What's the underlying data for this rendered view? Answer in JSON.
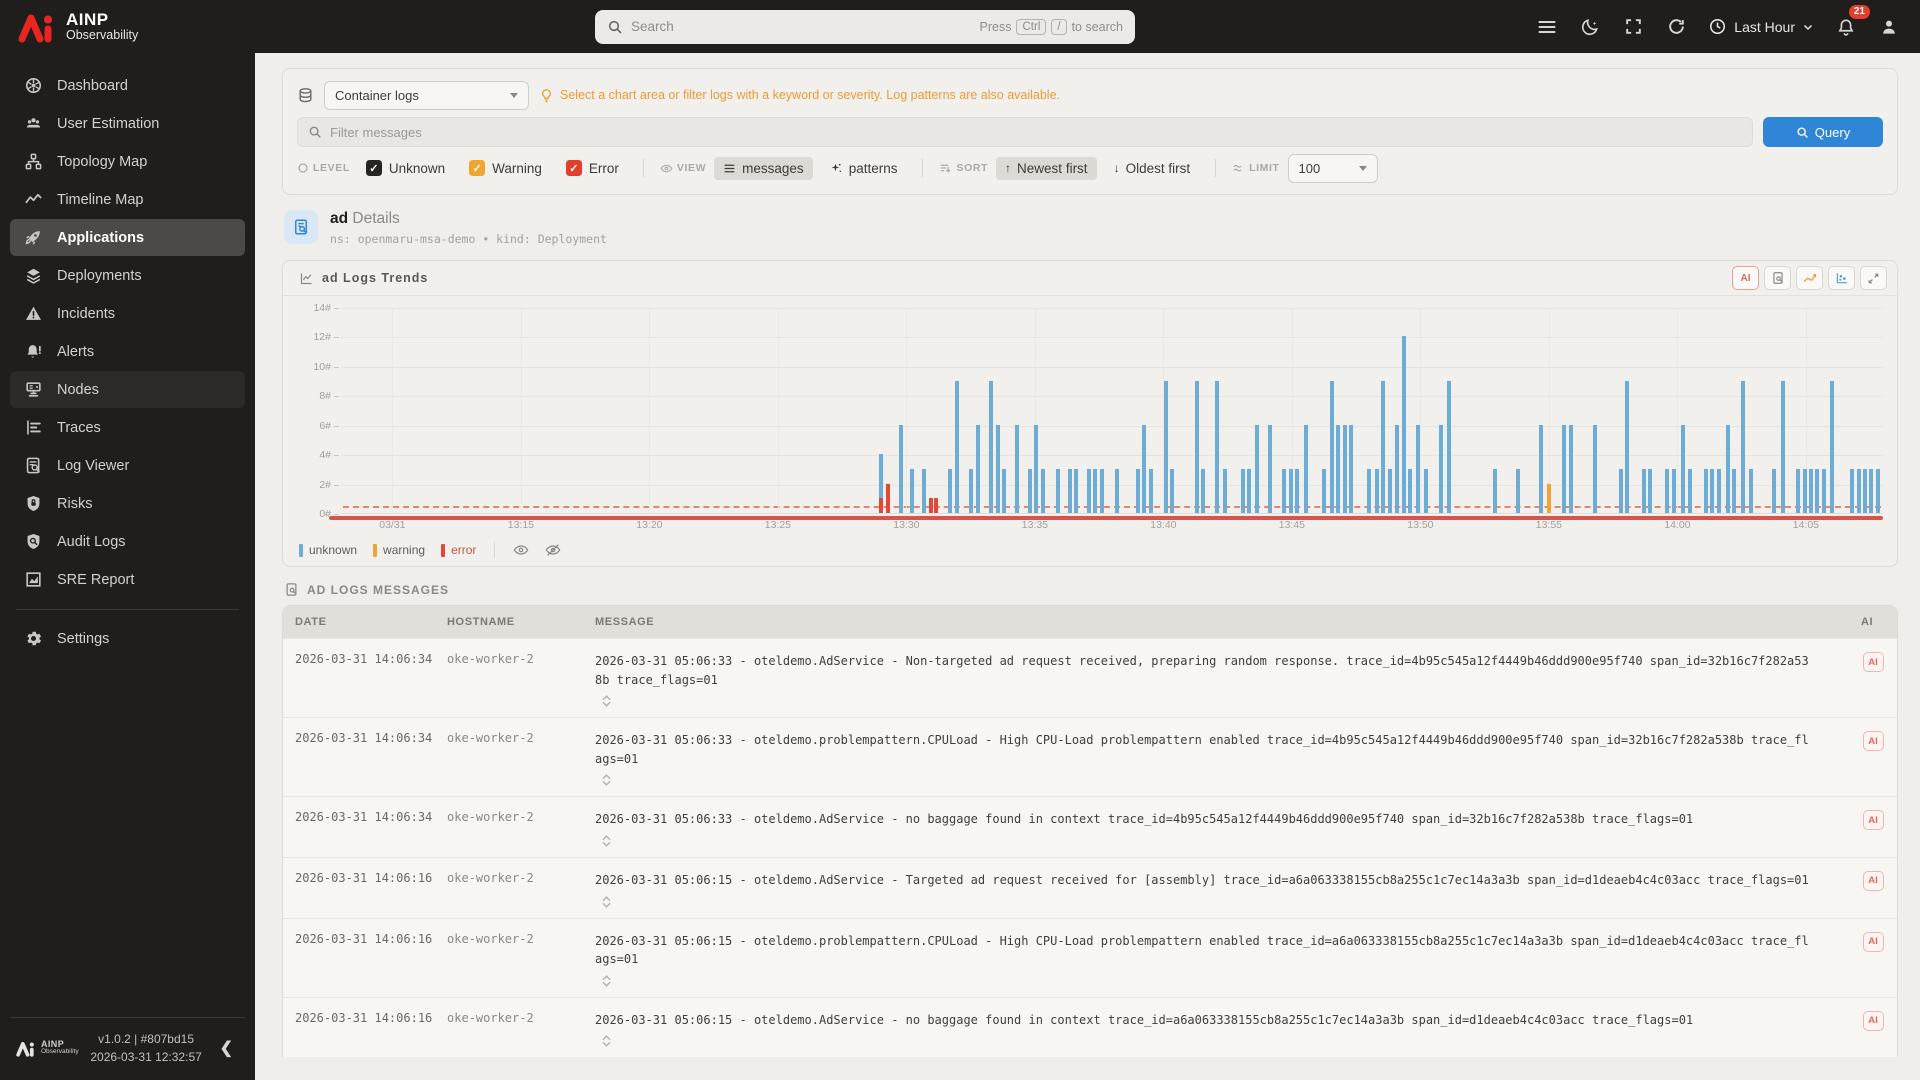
{
  "brand": {
    "name": "AINP",
    "product": "Observability"
  },
  "topbar": {
    "search_placeholder": "Search",
    "hint_press": "Press",
    "hint_key1": "Ctrl",
    "hint_key2": "/",
    "hint_suffix": "to search",
    "time_range": "Last Hour",
    "notification_count": "21"
  },
  "sidebar": {
    "items": [
      {
        "label": "Dashboard",
        "icon": "dashboard-icon",
        "state": "normal"
      },
      {
        "label": "User Estimation",
        "icon": "user-estimation-icon",
        "state": "normal"
      },
      {
        "label": "Topology Map",
        "icon": "topology-map-icon",
        "state": "normal"
      },
      {
        "label": "Timeline Map",
        "icon": "timeline-map-icon",
        "state": "normal"
      },
      {
        "label": "Applications",
        "icon": "applications-icon",
        "state": "active"
      },
      {
        "label": "Deployments",
        "icon": "deployments-icon",
        "state": "normal"
      },
      {
        "label": "Incidents",
        "icon": "incidents-icon",
        "state": "normal"
      },
      {
        "label": "Alerts",
        "icon": "alerts-icon",
        "state": "normal"
      },
      {
        "label": "Nodes",
        "icon": "nodes-icon",
        "state": "hovered"
      },
      {
        "label": "Traces",
        "icon": "traces-icon",
        "state": "normal"
      },
      {
        "label": "Log Viewer",
        "icon": "log-viewer-icon",
        "state": "normal"
      },
      {
        "label": "Risks",
        "icon": "risks-icon",
        "state": "normal"
      },
      {
        "label": "Audit Logs",
        "icon": "audit-logs-icon",
        "state": "normal"
      },
      {
        "label": "SRE Report",
        "icon": "sre-report-icon",
        "state": "normal"
      }
    ],
    "settings_label": "Settings",
    "footer": {
      "version": "v1.0.2 | #807bd15",
      "timestamp": "2026-03-31 12:32:57"
    }
  },
  "filters": {
    "source": "Container logs",
    "hint": "Select a chart area or filter logs with a keyword or severity. Log patterns are also available.",
    "filter_placeholder": "Filter messages",
    "query_label": "Query",
    "level_label": "LEVEL",
    "levels": [
      {
        "label": "Unknown",
        "color": "#262523",
        "checked": true
      },
      {
        "label": "Warning",
        "color": "#f0a432",
        "checked": true
      },
      {
        "label": "Error",
        "color": "#e23f2e",
        "checked": true
      }
    ],
    "view_label": "VIEW",
    "views": [
      {
        "label": "messages",
        "selected": true
      },
      {
        "label": "patterns",
        "selected": false
      }
    ],
    "sort_label": "SORT",
    "sorts": [
      {
        "label": "Newest first",
        "selected": true
      },
      {
        "label": "Oldest first",
        "selected": false
      }
    ],
    "limit_label": "LIMIT",
    "limit_value": "100"
  },
  "details": {
    "name": "ad",
    "title": "Details",
    "meta": "ns: openmaru-msa-demo • kind: Deployment"
  },
  "chart": {
    "title": "ad Logs Trends",
    "ai_button": "AI",
    "legend": [
      {
        "label": "unknown",
        "color": "#6dacd4"
      },
      {
        "label": "warning",
        "color": "#f0a432"
      },
      {
        "label": "error",
        "color": "#dd4a38"
      }
    ]
  },
  "chart_data": {
    "type": "bar",
    "stacked": true,
    "title": "ad Logs Trends",
    "ylim": [
      0,
      14
    ],
    "yticks": [
      "0#",
      "2#",
      "4#",
      "6#",
      "8#",
      "10#",
      "12#",
      "14#"
    ],
    "x_domain_minutes": 60,
    "x_start": "13:08",
    "xticks": [
      {
        "offset": 2,
        "label": "03/31"
      },
      {
        "offset": 7,
        "label": "13:15"
      },
      {
        "offset": 12,
        "label": "13:20"
      },
      {
        "offset": 17,
        "label": "13:25"
      },
      {
        "offset": 22,
        "label": "13:30"
      },
      {
        "offset": 27,
        "label": "13:35"
      },
      {
        "offset": 32,
        "label": "13:40"
      },
      {
        "offset": 37,
        "label": "13:45"
      },
      {
        "offset": 42,
        "label": "13:50"
      },
      {
        "offset": 47,
        "label": "13:55"
      },
      {
        "offset": 52,
        "label": "14:00"
      },
      {
        "offset": 57,
        "label": "14:05"
      }
    ],
    "series_order": [
      "error",
      "warning",
      "unknown"
    ],
    "colors": {
      "unknown": "#6dacd4",
      "warning": "#f0a432",
      "error": "#dd4a38"
    },
    "threshold_line": {
      "y": 0.5,
      "style": "dashed",
      "color": "#e0604e"
    },
    "bars": [
      [
        21.0,
        3,
        0,
        1
      ],
      [
        21.3,
        0,
        0,
        2
      ],
      [
        21.8,
        6,
        0,
        0
      ],
      [
        22.2,
        3,
        0,
        0
      ],
      [
        22.7,
        3,
        0,
        0
      ],
      [
        22.95,
        0,
        0,
        1
      ],
      [
        23.15,
        0,
        0,
        1
      ],
      [
        23.7,
        3,
        0,
        0
      ],
      [
        23.95,
        9,
        0,
        0
      ],
      [
        24.5,
        3,
        0,
        0
      ],
      [
        24.8,
        6,
        0,
        0
      ],
      [
        25.3,
        9,
        0,
        0
      ],
      [
        25.55,
        6,
        0,
        0
      ],
      [
        25.8,
        3,
        0,
        0
      ],
      [
        26.3,
        6,
        0,
        0
      ],
      [
        26.8,
        3,
        0,
        0
      ],
      [
        27.05,
        6,
        0,
        0
      ],
      [
        27.3,
        3,
        0,
        0
      ],
      [
        27.9,
        3,
        0,
        0
      ],
      [
        28.35,
        3,
        0,
        0
      ],
      [
        28.6,
        3,
        0,
        0
      ],
      [
        29.1,
        3,
        0,
        0
      ],
      [
        29.35,
        3,
        0,
        0
      ],
      [
        29.6,
        3,
        0,
        0
      ],
      [
        30.2,
        3,
        0,
        0
      ],
      [
        31.0,
        3,
        0,
        0
      ],
      [
        31.25,
        6,
        0,
        0
      ],
      [
        31.5,
        3,
        0,
        0
      ],
      [
        32.1,
        9,
        0,
        0
      ],
      [
        32.35,
        3,
        0,
        0
      ],
      [
        33.3,
        9,
        0,
        0
      ],
      [
        33.55,
        3,
        0,
        0
      ],
      [
        34.1,
        9,
        0,
        0
      ],
      [
        34.4,
        3,
        0,
        0
      ],
      [
        35.1,
        3,
        0,
        0
      ],
      [
        35.35,
        3,
        0,
        0
      ],
      [
        35.65,
        6,
        0,
        0
      ],
      [
        36.15,
        6,
        0,
        0
      ],
      [
        36.7,
        3,
        0,
        0
      ],
      [
        36.95,
        3,
        0,
        0
      ],
      [
        37.2,
        3,
        0,
        0
      ],
      [
        37.55,
        6,
        0,
        0
      ],
      [
        38.25,
        3,
        0,
        0
      ],
      [
        38.55,
        9,
        0,
        0
      ],
      [
        38.8,
        6,
        0,
        0
      ],
      [
        39.05,
        6,
        0,
        0
      ],
      [
        39.3,
        6,
        0,
        0
      ],
      [
        40.0,
        3,
        0,
        0
      ],
      [
        40.3,
        3,
        0,
        0
      ],
      [
        40.55,
        9,
        0,
        0
      ],
      [
        40.8,
        3,
        0,
        0
      ],
      [
        41.1,
        6,
        0,
        0
      ],
      [
        41.35,
        12,
        0,
        0
      ],
      [
        41.6,
        3,
        0,
        0
      ],
      [
        41.9,
        6,
        0,
        0
      ],
      [
        42.2,
        3,
        0,
        0
      ],
      [
        42.8,
        6,
        0,
        0
      ],
      [
        43.1,
        9,
        0,
        0
      ],
      [
        44.9,
        3,
        0,
        0
      ],
      [
        45.8,
        3,
        0,
        0
      ],
      [
        46.7,
        6,
        0,
        0
      ],
      [
        47.0,
        0,
        2,
        0
      ],
      [
        47.6,
        6,
        0,
        0
      ],
      [
        47.85,
        6,
        0,
        0
      ],
      [
        48.8,
        6,
        0,
        0
      ],
      [
        49.8,
        3,
        0,
        0
      ],
      [
        50.05,
        9,
        0,
        0
      ],
      [
        50.7,
        3,
        0,
        0
      ],
      [
        50.95,
        3,
        0,
        0
      ],
      [
        51.6,
        3,
        0,
        0
      ],
      [
        51.85,
        3,
        0,
        0
      ],
      [
        52.2,
        6,
        0,
        0
      ],
      [
        52.5,
        3,
        0,
        0
      ],
      [
        53.1,
        3,
        0,
        0
      ],
      [
        53.35,
        3,
        0,
        0
      ],
      [
        53.6,
        3,
        0,
        0
      ],
      [
        53.95,
        6,
        0,
        0
      ],
      [
        54.2,
        3,
        0,
        0
      ],
      [
        54.55,
        9,
        0,
        0
      ],
      [
        54.85,
        3,
        0,
        0
      ],
      [
        55.75,
        3,
        0,
        0
      ],
      [
        56.1,
        9,
        0,
        0
      ],
      [
        56.7,
        3,
        0,
        0
      ],
      [
        56.95,
        3,
        0,
        0
      ],
      [
        57.2,
        3,
        0,
        0
      ],
      [
        57.45,
        3,
        0,
        0
      ],
      [
        57.7,
        3,
        0,
        0
      ],
      [
        58.0,
        9,
        0,
        0
      ],
      [
        58.8,
        3,
        0,
        0
      ],
      [
        59.05,
        3,
        0,
        0
      ],
      [
        59.3,
        3,
        0,
        0
      ],
      [
        59.55,
        3,
        0,
        0
      ],
      [
        59.8,
        3,
        0,
        0
      ]
    ]
  },
  "table": {
    "section_title": "AD LOGS MESSAGES",
    "columns": [
      "DATE",
      "HOSTNAME",
      "MESSAGE",
      "AI"
    ],
    "ai_badge": "AI",
    "rows": [
      {
        "date": "2026-03-31 14:06:34",
        "host": "oke-worker-2",
        "message": "2026-03-31 05:06:33 - oteldemo.AdService - Non-targeted ad request received, preparing random response. trace_id=4b95c545a12f4449b46ddd900e95f740 span_id=32b16c7f282a538b trace_flags=01"
      },
      {
        "date": "2026-03-31 14:06:34",
        "host": "oke-worker-2",
        "message": "2026-03-31 05:06:33 - oteldemo.problempattern.CPULoad - High CPU-Load problempattern enabled trace_id=4b95c545a12f4449b46ddd900e95f740 span_id=32b16c7f282a538b trace_flags=01"
      },
      {
        "date": "2026-03-31 14:06:34",
        "host": "oke-worker-2",
        "message": "2026-03-31 05:06:33 - oteldemo.AdService - no baggage found in context trace_id=4b95c545a12f4449b46ddd900e95f740 span_id=32b16c7f282a538b trace_flags=01"
      },
      {
        "date": "2026-03-31 14:06:16",
        "host": "oke-worker-2",
        "message": "2026-03-31 05:06:15 - oteldemo.AdService - Targeted ad request received for [assembly] trace_id=a6a063338155cb8a255c1c7ec14a3a3b span_id=d1deaeb4c4c03acc trace_flags=01"
      },
      {
        "date": "2026-03-31 14:06:16",
        "host": "oke-worker-2",
        "message": "2026-03-31 05:06:15 - oteldemo.problempattern.CPULoad - High CPU-Load problempattern enabled trace_id=a6a063338155cb8a255c1c7ec14a3a3b span_id=d1deaeb4c4c03acc trace_flags=01"
      },
      {
        "date": "2026-03-31 14:06:16",
        "host": "oke-worker-2",
        "message": "2026-03-31 05:06:15 - oteldemo.AdService - no baggage found in context trace_id=a6a063338155cb8a255c1c7ec14a3a3b span_id=d1deaeb4c4c03acc trace_flags=01"
      }
    ]
  }
}
